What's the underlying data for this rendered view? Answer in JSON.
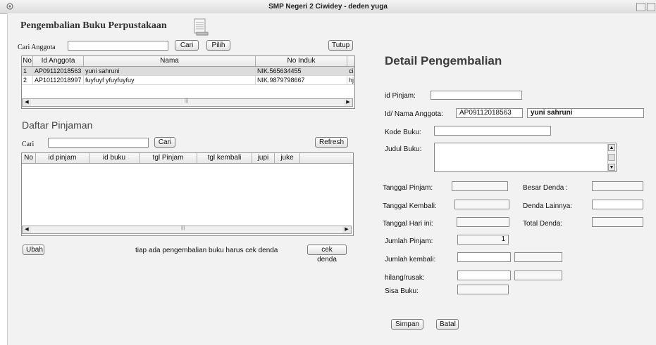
{
  "window": {
    "title": "SMP Negeri 2 Ciwidey - deden yuga"
  },
  "left": {
    "title": "Pengembalian Buku Perpustakaan",
    "search_label": "Cari Anggota",
    "search_value": "",
    "cari_button": "Cari",
    "pilih_button": "Pilih",
    "tutup_button": "Tutup",
    "members_table": {
      "headers": [
        "No",
        "Id Anggota",
        "Nama",
        "No Induk",
        ""
      ],
      "rows": [
        [
          "1",
          "AP09112018563",
          "yuni sahruni",
          "NIK.565634455",
          "ci"
        ],
        [
          "2",
          "AP10112018997",
          "fuyfuyf yfuyfuyfuy",
          "NIK.9879798667",
          "hj"
        ]
      ]
    },
    "daftar_title": "Daftar Pinjaman",
    "cari_label": "Cari",
    "cari2_button": "Cari",
    "refresh_button": "Refresh",
    "loans_table": {
      "headers": [
        "No",
        "id pinjam",
        "id buku",
        "tgl Pinjam",
        "tgl kembali",
        "jupi",
        "juke"
      ],
      "rows": []
    },
    "ubah_button": "Ubah",
    "note": "tiap ada pengembalian buku harus cek denda",
    "cek_denda_button": "cek denda"
  },
  "right": {
    "title": "Detail Pengembalian",
    "id_pinjam_label": "id Pinjam:",
    "id_pinjam_value": "",
    "anggota_label": "Id/ Nama Anggota:",
    "anggota_id_value": "AP09112018563",
    "anggota_nama_value": "yuni sahruni",
    "kode_buku_label": "Kode Buku:",
    "kode_buku_value": "",
    "judul_buku_label": "Judul Buku:",
    "judul_buku_value": "",
    "tgl_pinjam_label": "Tanggal Pinjam:",
    "tgl_pinjam_value": "",
    "besar_denda_label": "Besar Denda :",
    "besar_denda_value": "",
    "tgl_kembali_label": "Tanggal Kembali:",
    "tgl_kembali_value": "",
    "denda_lainnya_label": "Denda Lainnya:",
    "denda_lainnya_value": "",
    "tgl_hari_ini_label": "Tanggal Hari ini:",
    "tgl_hari_ini_value": "",
    "total_denda_label": "Total Denda:",
    "total_denda_value": "",
    "jumlah_pinjam_label": "Jumlah Pinjam:",
    "jumlah_pinjam_value": "1",
    "jumlah_kembali_label": "Jumlah kembali:",
    "hilang_label": "hilang/rusak:",
    "sisa_buku_label": "Sisa Buku:",
    "simpan_button": "Simpan",
    "batal_button": "Batal"
  }
}
